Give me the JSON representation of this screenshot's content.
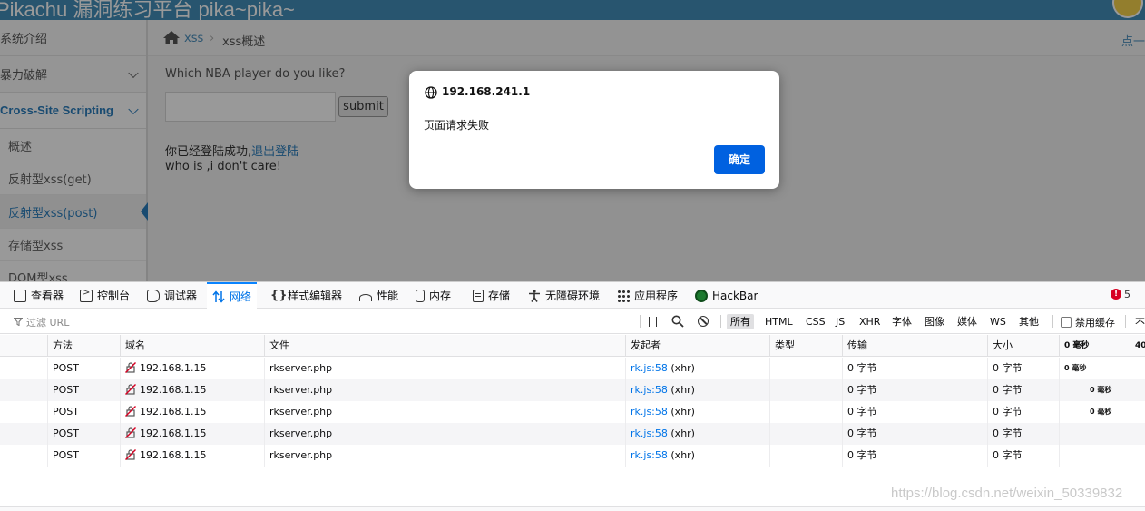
{
  "page": {
    "brand": "Pikachu 漏洞练习平台 pika~pika~",
    "sidebar": {
      "items": [
        {
          "label": "系统介绍"
        },
        {
          "label": "暴力破解"
        },
        {
          "label": "Cross-Site Scripting"
        }
      ],
      "sub_items": [
        {
          "label": "概述"
        },
        {
          "label": "反射型xss(get)"
        },
        {
          "label": "反射型xss(post)"
        },
        {
          "label": "存储型xss"
        },
        {
          "label": "DOM型xss"
        }
      ]
    },
    "breadcrumb": {
      "link": "xss",
      "separator": "›",
      "current": "xss概述",
      "right": "点一"
    },
    "form": {
      "question": "Which NBA player do you like?",
      "input_value": "",
      "submit_label": "submit"
    },
    "login_text": "你已经登陆成功,",
    "logout_link": "退出登陆",
    "who_text": "who is ,i don't care!"
  },
  "dialog": {
    "host": "192.168.241.1",
    "message": "页面请求失败",
    "ok_label": "确定",
    "accent": "#0061e0"
  },
  "devtools": {
    "tabs": [
      {
        "label": "查看器",
        "icon": "inspector-icon"
      },
      {
        "label": "控制台",
        "icon": "console-icon"
      },
      {
        "label": "调试器",
        "icon": "debugger-icon"
      },
      {
        "label": "网络",
        "icon": "network-icon",
        "active": true
      },
      {
        "label": "样式编辑器",
        "icon": "style-editor-icon"
      },
      {
        "label": "性能",
        "icon": "performance-icon"
      },
      {
        "label": "内存",
        "icon": "memory-icon"
      },
      {
        "label": "存储",
        "icon": "storage-icon"
      },
      {
        "label": "无障碍环境",
        "icon": "accessibility-icon"
      },
      {
        "label": "应用程序",
        "icon": "application-icon"
      },
      {
        "label": "HackBar",
        "icon": "hackbar-icon"
      }
    ],
    "error_count": "5",
    "filter_placeholder": "过滤 URL",
    "type_filters": [
      "所有",
      "HTML",
      "CSS",
      "JS",
      "XHR",
      "字体",
      "图像",
      "媒体",
      "WS",
      "其他"
    ],
    "disable_cache_label": "禁用缓存",
    "throttle_label": "不",
    "columns": [
      "方法",
      "域名",
      "文件",
      "发起者",
      "类型",
      "传输",
      "大小",
      "0 毫秒",
      "40"
    ],
    "requests": [
      {
        "method": "POST",
        "domain": "192.168.1.15",
        "file": "rkserver.php",
        "initiator_link": "rk.js:58",
        "initiator_type": "(xhr)",
        "type": "",
        "transferred": "0 字节",
        "size": "0 字节",
        "timing": "0 毫秒"
      },
      {
        "method": "POST",
        "domain": "192.168.1.15",
        "file": "rkserver.php",
        "initiator_link": "rk.js:58",
        "initiator_type": "(xhr)",
        "type": "",
        "transferred": "0 字节",
        "size": "0 字节",
        "timing": "0 毫秒"
      },
      {
        "method": "POST",
        "domain": "192.168.1.15",
        "file": "rkserver.php",
        "initiator_link": "rk.js:58",
        "initiator_type": "(xhr)",
        "type": "",
        "transferred": "0 字节",
        "size": "0 字节",
        "timing": "0 毫秒"
      },
      {
        "method": "POST",
        "domain": "192.168.1.15",
        "file": "rkserver.php",
        "initiator_link": "rk.js:58",
        "initiator_type": "(xhr)",
        "type": "",
        "transferred": "0 字节",
        "size": "0 字节",
        "timing": ""
      },
      {
        "method": "POST",
        "domain": "192.168.1.15",
        "file": "rkserver.php",
        "initiator_link": "rk.js:58",
        "initiator_type": "(xhr)",
        "type": "",
        "transferred": "0 字节",
        "size": "0 字节",
        "timing": ""
      }
    ]
  },
  "watermark": "https://blog.csdn.net/weixin_50339832"
}
